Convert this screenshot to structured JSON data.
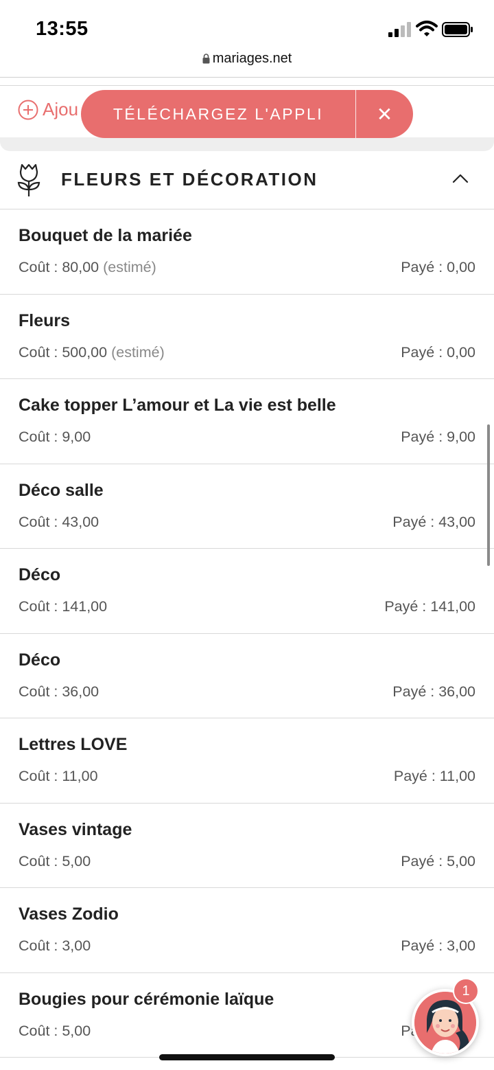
{
  "status_bar": {
    "time": "13:55"
  },
  "browser": {
    "url": "mariages.net"
  },
  "add_row": {
    "label": "Ajou"
  },
  "app_banner": {
    "label": "TÉLÉCHARGEZ L'APPLI",
    "close": "✕"
  },
  "section": {
    "title": "FLEURS ET DÉCORATION"
  },
  "items": [
    {
      "name": "Bouquet de la mariée",
      "cost": "Coût : 80,00",
      "estimated": "(estimé)",
      "paid": "Payé : 0,00"
    },
    {
      "name": "Fleurs",
      "cost": "Coût : 500,00",
      "estimated": "(estimé)",
      "paid": "Payé : 0,00"
    },
    {
      "name": "Cake topper L’amour et La vie est belle",
      "cost": "Coût : 9,00",
      "estimated": "",
      "paid": "Payé : 9,00"
    },
    {
      "name": "Déco salle",
      "cost": "Coût : 43,00",
      "estimated": "",
      "paid": "Payé : 43,00"
    },
    {
      "name": "Déco",
      "cost": "Coût : 141,00",
      "estimated": "",
      "paid": "Payé : 141,00"
    },
    {
      "name": "Déco",
      "cost": "Coût : 36,00",
      "estimated": "",
      "paid": "Payé : 36,00"
    },
    {
      "name": "Lettres LOVE",
      "cost": "Coût : 11,00",
      "estimated": "",
      "paid": "Payé : 11,00"
    },
    {
      "name": "Vases vintage",
      "cost": "Coût : 5,00",
      "estimated": "",
      "paid": "Payé : 5,00"
    },
    {
      "name": "Vases Zodio",
      "cost": "Coût : 3,00",
      "estimated": "",
      "paid": "Payé : 3,00"
    },
    {
      "name": "Bougies pour cérémonie laïque",
      "cost": "Coût : 5,00",
      "estimated": "",
      "paid": "Payé : 5,00"
    }
  ],
  "chat": {
    "badge": "1"
  },
  "colors": {
    "accent": "#e86e6e",
    "divider": "#d8d8d8"
  }
}
